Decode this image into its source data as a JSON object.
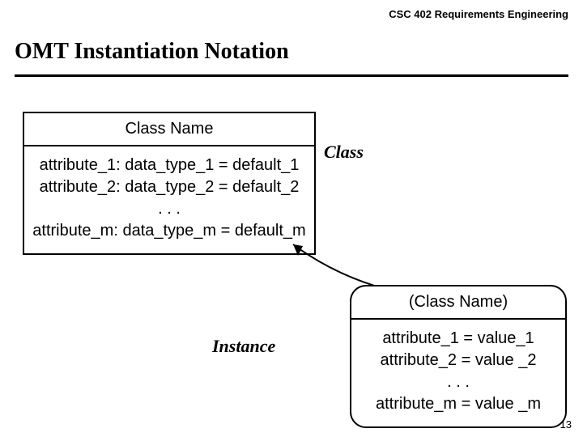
{
  "header": {
    "course": "CSC 402 Requirements Engineering"
  },
  "title": "OMT Instantiation Notation",
  "labels": {
    "class": "Class",
    "instance": "Instance"
  },
  "class_box": {
    "name": "Class Name",
    "lines": {
      "a1": "attribute_1: data_type_1 = default_1",
      "a2": "attribute_2: data_type_2 = default_2",
      "dots": ". . .",
      "am": "attribute_m: data_type_m = default_m"
    }
  },
  "instance_box": {
    "name": "(Class Name)",
    "lines": {
      "a1": "attribute_1 = value_1",
      "a2": "attribute_2 = value _2",
      "dots": ". . .",
      "am": "attribute_m = value _m"
    }
  },
  "page_number": "13"
}
